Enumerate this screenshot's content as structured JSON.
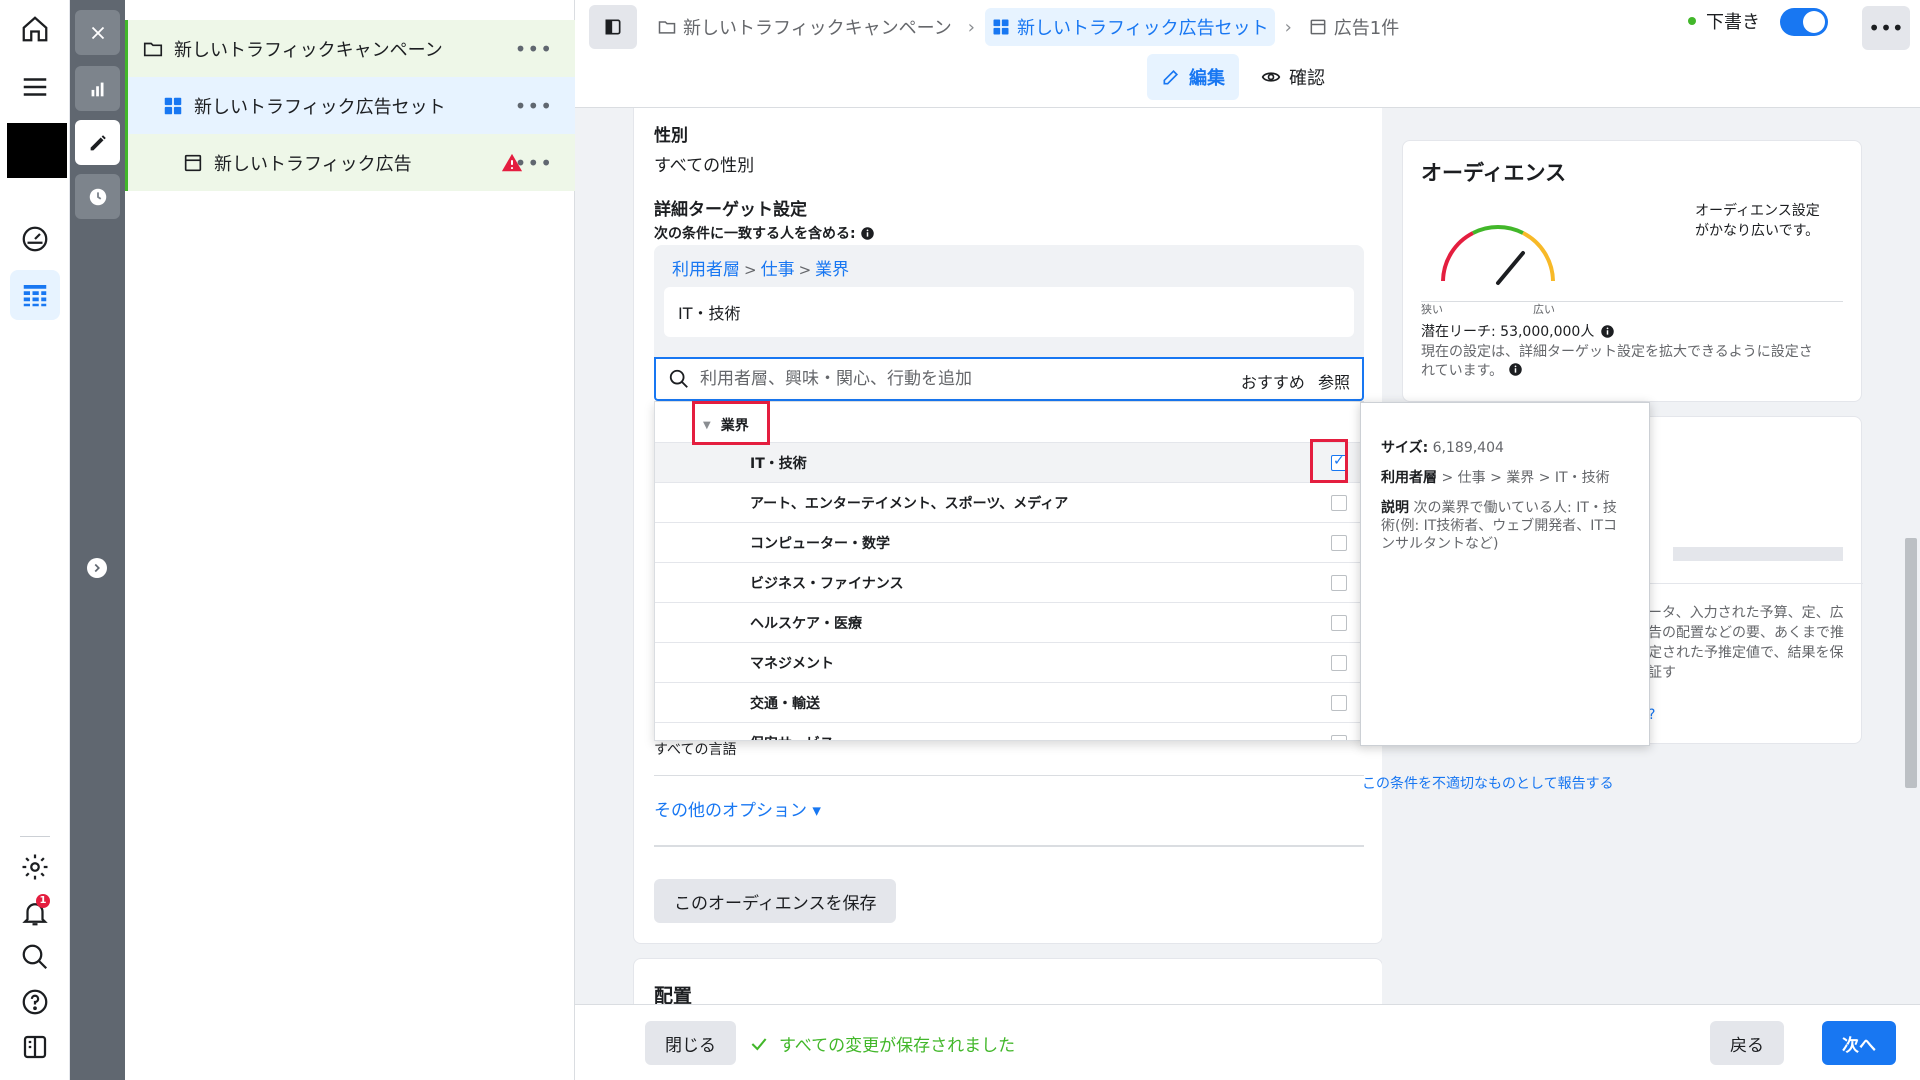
{
  "colors": {
    "accent": "#1877f2",
    "success": "#42b72a",
    "alert": "#e41e3f",
    "tree_campaign_bg": "#eef7e8",
    "tree_adset_bg": "#e7f3ff",
    "tree_ad_bg": "#eef7e8"
  },
  "rail": {
    "icons": [
      "home-icon",
      "menu-icon",
      "gauge-icon",
      "table-icon",
      "settings-icon",
      "bell-icon",
      "search-icon",
      "help-icon",
      "panel-icon"
    ],
    "notification_count": "1"
  },
  "strip": {
    "icons": [
      "close-icon",
      "chart-icon",
      "edit-icon",
      "clock-icon",
      "chevron-right-icon"
    ]
  },
  "tree": {
    "campaign": "新しいトラフィックキャンペーン",
    "adset": "新しいトラフィック広告セット",
    "ad": "新しいトラフィック広告",
    "more": "•••"
  },
  "header": {
    "breadcrumb": [
      {
        "label": "新しいトラフィックキャンペーン",
        "icon": "folder-icon"
      },
      {
        "label": "新しいトラフィック広告セット",
        "icon": "grid-icon"
      },
      {
        "label": "広告1件",
        "icon": "ad-icon"
      }
    ],
    "draft_label": "下書き",
    "more": "•••",
    "tabs": [
      {
        "label": "編集",
        "icon": "pencil-icon",
        "active": true
      },
      {
        "label": "確認",
        "icon": "eye-icon",
        "active": false
      }
    ]
  },
  "audience": {
    "gender_label": "性別",
    "gender_value": "すべての性別",
    "detailed_label": "詳細ターゲット設定",
    "include_label": "次の条件に一致する人を含める:",
    "path": [
      "利用者層",
      "仕事",
      "業界"
    ],
    "path_sep": ">",
    "selected_chip": "IT・技術",
    "search_placeholder": "利用者層、興味・関心、行動を追加",
    "search_suggest": "おすすめ",
    "search_browse": "参照",
    "dropdown": {
      "category": "業界",
      "items": [
        {
          "label": "IT・技術",
          "checked": true
        },
        {
          "label": "アート、エンターテイメント、スポーツ、メディア",
          "checked": false
        },
        {
          "label": "コンピューター・数学",
          "checked": false
        },
        {
          "label": "ビジネス・ファイナンス",
          "checked": false
        },
        {
          "label": "ヘルスケア・医療",
          "checked": false
        },
        {
          "label": "マネジメント",
          "checked": false
        },
        {
          "label": "交通・輸送",
          "checked": false
        },
        {
          "label": "保安サービス",
          "checked": false
        }
      ]
    },
    "behind_text": "すべての言語",
    "other_options": "その他のオプション ▾",
    "save_audience": "このオーディエンスを保存",
    "placement_label": "配置"
  },
  "tooltip": {
    "size_label": "サイズ:",
    "size_value": "6,189,404",
    "path_label": "利用者層",
    "path_value": "> 仕事 > 業界 > IT・技術",
    "desc_label": "説明",
    "desc_value": "次の業界で働いている人: IT・技術(例: IT技術者、ウェブ開発者、ITコンサルタントなど)"
  },
  "report_link": "この条件を不適切なものとして報告する",
  "audience_def": {
    "title": "オーディエンス",
    "gauge_narrow": "狭い",
    "gauge_wide": "広い",
    "note": "オーディエンス設定がかなり広いです。",
    "reach": "潜在リーチ: 53,000,000人",
    "reach_note": "現在の設定は、詳細ターゲット設定を拡大できるように設定されています。"
  },
  "estimate": {
    "text": "ータ、入力された予算、定、広告の配置などの要、あくまで推定された予推定値で、結果を保証す",
    "link": "?"
  },
  "footer": {
    "close": "閉じる",
    "saved": "すべての変更が保存されました",
    "back": "戻る",
    "next": "次へ"
  }
}
